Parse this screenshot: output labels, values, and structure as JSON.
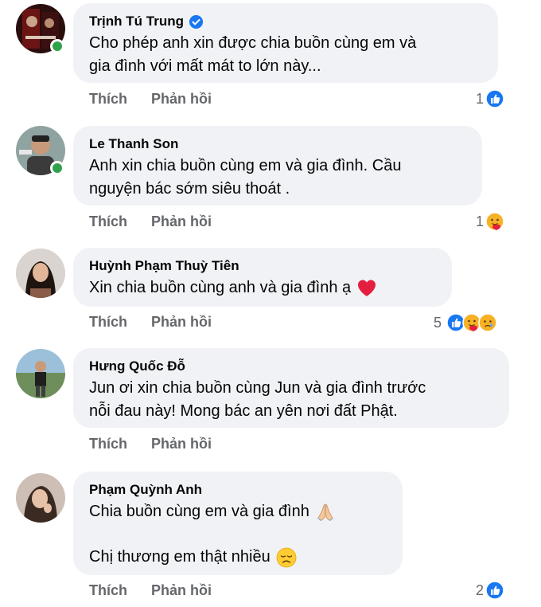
{
  "colors": {
    "like_blue": "#1877f2",
    "online_green": "#31a24c",
    "heart_red": "#e41e3f"
  },
  "comments": [
    {
      "name": "Trịnh Tú Trung",
      "verified": true,
      "lines": [
        "Cho phép anh xin được chia buồn cùng em và",
        "gia đình với mất mát to lớn này..."
      ],
      "like": "Thích",
      "reply": "Phản hồi",
      "reaction_count": "1",
      "reactions": [
        "like-icon"
      ]
    },
    {
      "name": "Le Thanh Son",
      "lines": [
        "Anh xin chia buồn cùng em và gia đình. Cầu",
        "nguyện bác sớm siêu thoát ."
      ],
      "like": "Thích",
      "reply": "Phản hồi",
      "reaction_count": "1",
      "reactions": [
        "care-icon"
      ]
    },
    {
      "name": "Huỳnh Phạm Thuỳ Tiên",
      "lines": [
        "Xin chia buồn cùng anh và gia đình ạ"
      ],
      "like": "Thích",
      "reply": "Phản hồi",
      "reaction_count": "5",
      "reactions": [
        "like-icon",
        "care-icon",
        "sad-icon"
      ]
    },
    {
      "name": "Hưng Quốc Đỗ",
      "lines": [
        "Jun ơi xin chia buồn cùng Jun và gia đình trước",
        "nỗi đau này! Mong bác an yên nơi đất Phật."
      ],
      "like": "Thích",
      "reply": "Phản hồi"
    },
    {
      "name": "Phạm Quỳnh Anh",
      "lines": [
        "Chia buồn cùng em và gia đình",
        "Chị thương em thật nhiều"
      ],
      "like": "Thích",
      "reply": "Phản hồi",
      "reaction_count": "2",
      "reactions": [
        "like-icon"
      ]
    }
  ]
}
